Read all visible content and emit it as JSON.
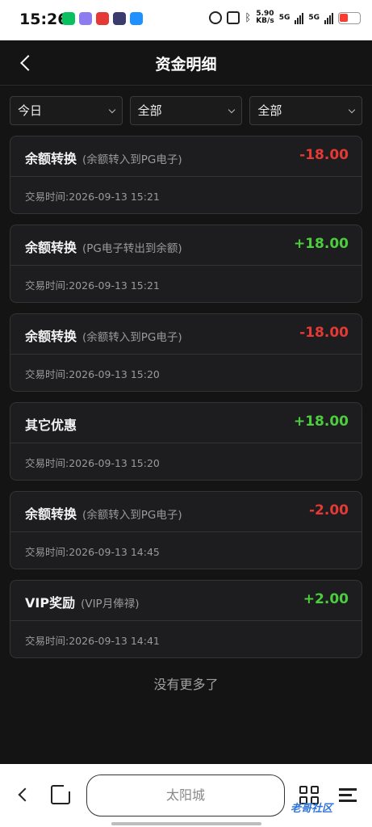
{
  "status_bar": {
    "time": "15:26",
    "net_speed_value": "5.90",
    "net_speed_unit": "KB/s",
    "sim1": "5G",
    "sim2": "5G"
  },
  "header": {
    "title": "资金明细"
  },
  "filters": [
    {
      "value": "今日"
    },
    {
      "value": "全部"
    },
    {
      "value": "全部"
    }
  ],
  "records": [
    {
      "type": "余额转换",
      "desc": "(余额转入到PG电子)",
      "amount": "-18.00",
      "sign": "neg",
      "time": "交易时间:2026-09-13 15:21"
    },
    {
      "type": "余额转换",
      "desc": "(PG电子转出到余额)",
      "amount": "+18.00",
      "sign": "pos",
      "time": "交易时间:2026-09-13 15:21"
    },
    {
      "type": "余额转换",
      "desc": "(余额转入到PG电子)",
      "amount": "-18.00",
      "sign": "neg",
      "time": "交易时间:2026-09-13 15:20"
    },
    {
      "type": "其它优惠",
      "desc": "",
      "amount": "+18.00",
      "sign": "pos",
      "time": "交易时间:2026-09-13 15:20"
    },
    {
      "type": "余额转换",
      "desc": "(余额转入到PG电子)",
      "amount": "-2.00",
      "sign": "neg",
      "time": "交易时间:2026-09-13 14:45"
    },
    {
      "type": "VIP奖励",
      "desc": "(VIP月俸禄)",
      "amount": "+2.00",
      "sign": "pos",
      "time": "交易时间:2026-09-13 14:41"
    }
  ],
  "footer_text": "没有更多了",
  "browser": {
    "url_text": "太阳城",
    "watermark": "老哥社区"
  },
  "colors": {
    "negative": "#e53935",
    "positive": "#4ccd3d",
    "background": "#141414",
    "card": "#1d1d1f"
  }
}
